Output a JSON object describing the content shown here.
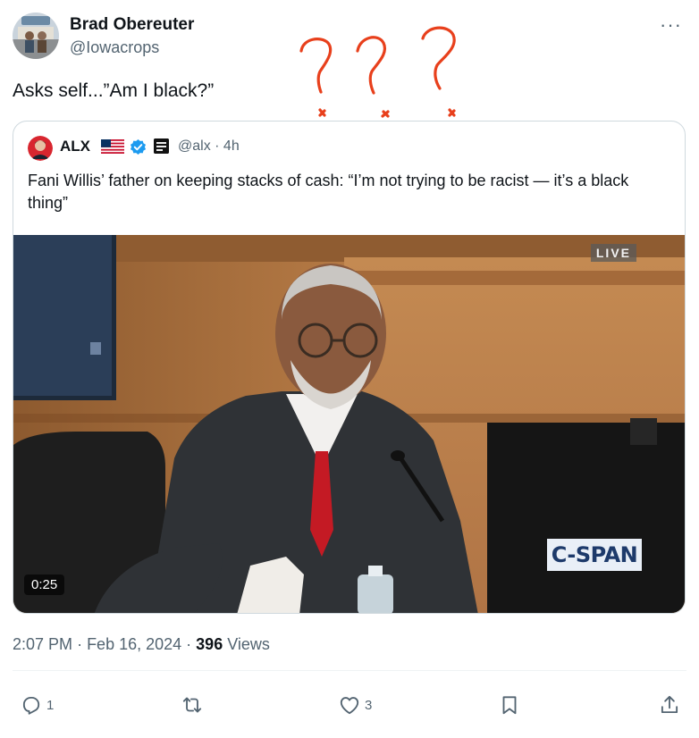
{
  "author": {
    "name": "Brad Obereuter",
    "handle": "@Iowacrops"
  },
  "tweet": {
    "text": "Asks self...”Am I black?”"
  },
  "quoted": {
    "name": "ALX",
    "flag": "US flag",
    "handle_time": "@alx · 4h",
    "text": "Fani Willis’ father on keeping stacks of cash: “I’m not trying to be racist — it’s a black thing”",
    "video": {
      "live_label": "LIVE",
      "network_label": "C-SPAN",
      "duration": "0:25"
    }
  },
  "meta": {
    "time": "2:07 PM",
    "date": "Feb 16, 2024",
    "views_count": "396",
    "views_label": "Views"
  },
  "actions": {
    "reply_count": "1",
    "retweet_count": "",
    "like_count": "3"
  },
  "colors": {
    "text_primary": "#0f1419",
    "text_secondary": "#536471",
    "verified_blue": "#1d9bf0",
    "scribble_red": "#e8401c"
  }
}
